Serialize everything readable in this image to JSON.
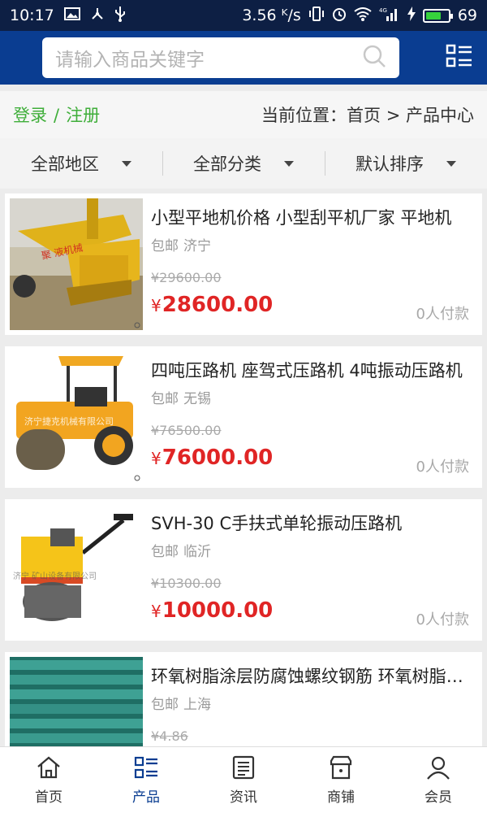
{
  "status_bar": {
    "time": "10:17",
    "speed": "3.56 ᴷ/s",
    "signal": "4G",
    "battery": "69",
    "battery_level": 0.69
  },
  "header": {
    "search_placeholder": "请输入商品关键字"
  },
  "location_bar": {
    "login": "登录",
    "separator": "/",
    "register": "注册",
    "current_location": "当前位置：首页 > 产品中心"
  },
  "filters": {
    "region": "全部地区",
    "category": "全部分类",
    "sort": "默认排序"
  },
  "products": [
    {
      "title": "小型平地机价格 小型刮平机厂家 平地机",
      "shipping": "包邮",
      "city": "济宁",
      "old_price": "¥29600.00",
      "currency": "¥",
      "price": "28600.00",
      "payers": "0人付款"
    },
    {
      "title": "四吨压路机 座驾式压路机 4吨振动压路机",
      "shipping": "包邮",
      "city": "无锡",
      "old_price": "¥76500.00",
      "currency": "¥",
      "price": "76000.00",
      "payers": "0人付款"
    },
    {
      "title": "SVH-30 C手扶式单轮振动压路机",
      "shipping": "包邮",
      "city": "临沂",
      "old_price": "¥10300.00",
      "currency": "¥",
      "price": "10000.00",
      "payers": "0人付款"
    },
    {
      "title": "环氧树脂涂层防腐蚀螺纹钢筋 环氧树脂涂层钢筋",
      "shipping": "包邮",
      "city": "上海",
      "old_price": "¥4.86",
      "currency": "¥",
      "price": "",
      "payers": ""
    }
  ],
  "tabs": [
    {
      "label": "首页",
      "icon": "home-icon",
      "active": false
    },
    {
      "label": "产品",
      "icon": "list-icon",
      "active": true
    },
    {
      "label": "资讯",
      "icon": "news-icon",
      "active": false
    },
    {
      "label": "商铺",
      "icon": "store-icon",
      "active": false
    },
    {
      "label": "会员",
      "icon": "user-icon",
      "active": false
    }
  ],
  "colors": {
    "header_bg": "#0a3d91",
    "status_bg": "#0d1f44",
    "login_green": "#3fae3a",
    "price_red": "#e02525",
    "active_tab": "#0a3d91"
  }
}
